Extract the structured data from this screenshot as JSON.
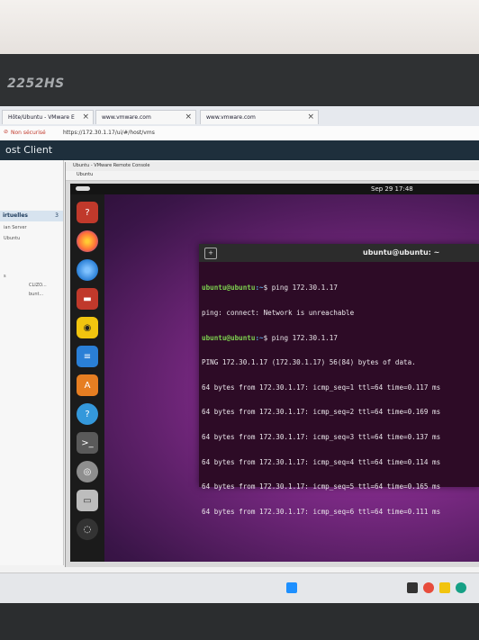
{
  "monitor": {
    "brand": "2252HS"
  },
  "browser": {
    "tabs": [
      {
        "label": "Hôte/Ubuntu - VMware E",
        "active": true
      },
      {
        "label": "www.vmware.com",
        "active": false
      },
      {
        "label": "www.vmware.com",
        "active": false
      }
    ],
    "security_label": "Non sécurisé",
    "url": "https://172.30.1.17/ui/#/host/vms"
  },
  "app": {
    "title": "ost Client"
  },
  "sidebar": {
    "header_label": "irtuelles",
    "header_count": "3",
    "lines": [
      "ian Server",
      "Ubuntu",
      "s",
      "CLIZO...",
      "bunt..."
    ]
  },
  "console": {
    "window_title": "Ubuntu - VMware Remote Console",
    "tab_label": "Ubuntu"
  },
  "ubuntu": {
    "clock": "Sep 29  17:48",
    "dock": [
      {
        "icon": "help-icon",
        "color": "#c0392b"
      },
      {
        "icon": "firefox-icon",
        "color": "#ff7139"
      },
      {
        "icon": "thunderbird-icon",
        "color": "#2a7fd6"
      },
      {
        "icon": "files-icon",
        "color": "#c0392b"
      },
      {
        "icon": "rhythmbox-icon",
        "color": "#f1c40f"
      },
      {
        "icon": "writer-icon",
        "color": "#2a7fd6"
      },
      {
        "icon": "app-center-icon",
        "color": "#e67e22"
      },
      {
        "icon": "help-center-icon",
        "color": "#3498db"
      },
      {
        "icon": "terminal-icon",
        "color": "#5a5a5a"
      },
      {
        "icon": "dvd-icon",
        "color": "#8e8e8e"
      },
      {
        "icon": "trash-icon",
        "color": "#bdbdbd"
      },
      {
        "icon": "ubuntu-logo-icon",
        "color": "#333"
      }
    ]
  },
  "terminal": {
    "title": "ubuntu@ubuntu: ~",
    "new_tab_icon": "new-tab-icon",
    "lines": [
      {
        "prompt": "ubuntu@ubuntu",
        "path": ":~",
        "text": "$ ping 172.30.1.17"
      },
      {
        "text": "ping: connect: Network is unreachable"
      },
      {
        "prompt": "ubuntu@ubuntu",
        "path": ":~",
        "text": "$ ping 172.30.1.17"
      },
      {
        "text": "PING 172.30.1.17 (172.30.1.17) 56(84) bytes of data."
      },
      {
        "text": "64 bytes from 172.30.1.17: icmp_seq=1 ttl=64 time=0.117 ms"
      },
      {
        "text": "64 bytes from 172.30.1.17: icmp_seq=2 ttl=64 time=0.169 ms"
      },
      {
        "text": "64 bytes from 172.30.1.17: icmp_seq=3 ttl=64 time=0.137 ms"
      },
      {
        "text": "64 bytes from 172.30.1.17: icmp_seq=4 ttl=64 time=0.114 ms"
      },
      {
        "text": "64 bytes from 172.30.1.17: icmp_seq=5 ttl=64 time=0.165 ms"
      },
      {
        "text": "64 bytes from 172.30.1.17: icmp_seq=6 ttl=64 time=0.111 ms"
      }
    ]
  },
  "taskbar": {
    "icons": [
      "start-icon",
      "search-icon",
      "chrome-icon",
      "folder-icon",
      "edge-icon"
    ]
  }
}
